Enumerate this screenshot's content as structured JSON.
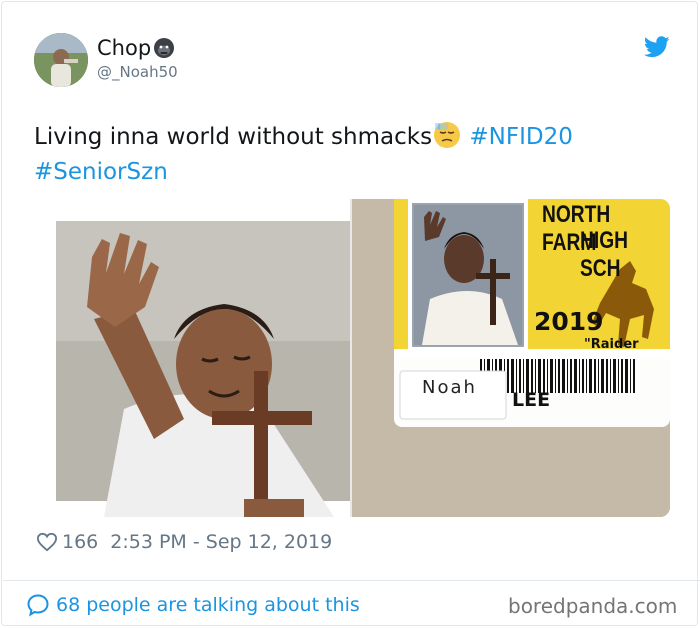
{
  "tweet": {
    "display_name": "Chop",
    "name_emoji_icon": "gorilla-icon",
    "handle": "@_Noah50",
    "text_before_emoji": "Living inna world without shmacks",
    "emoji_icon": "downcast-face-with-sweat-icon",
    "hashtags": [
      "#NFID20",
      "#SeniorSzn"
    ],
    "likes": "166",
    "timestamp": "2:53 PM - Sep 12, 2019",
    "talking": "68 people are talking about this"
  },
  "media": {
    "id_card": {
      "school_line1": "NORTH FARM",
      "school_line2": "HIGH SCH",
      "year": "2019",
      "mascot": "\"Raider",
      "first_name": "Noah",
      "last_name": "LEE"
    }
  },
  "watermark": "boredpanda.com",
  "colors": {
    "link": "#1b95e0",
    "muted": "#657786",
    "card_yellow": "#f2d535",
    "border": "#e1e8ed"
  }
}
